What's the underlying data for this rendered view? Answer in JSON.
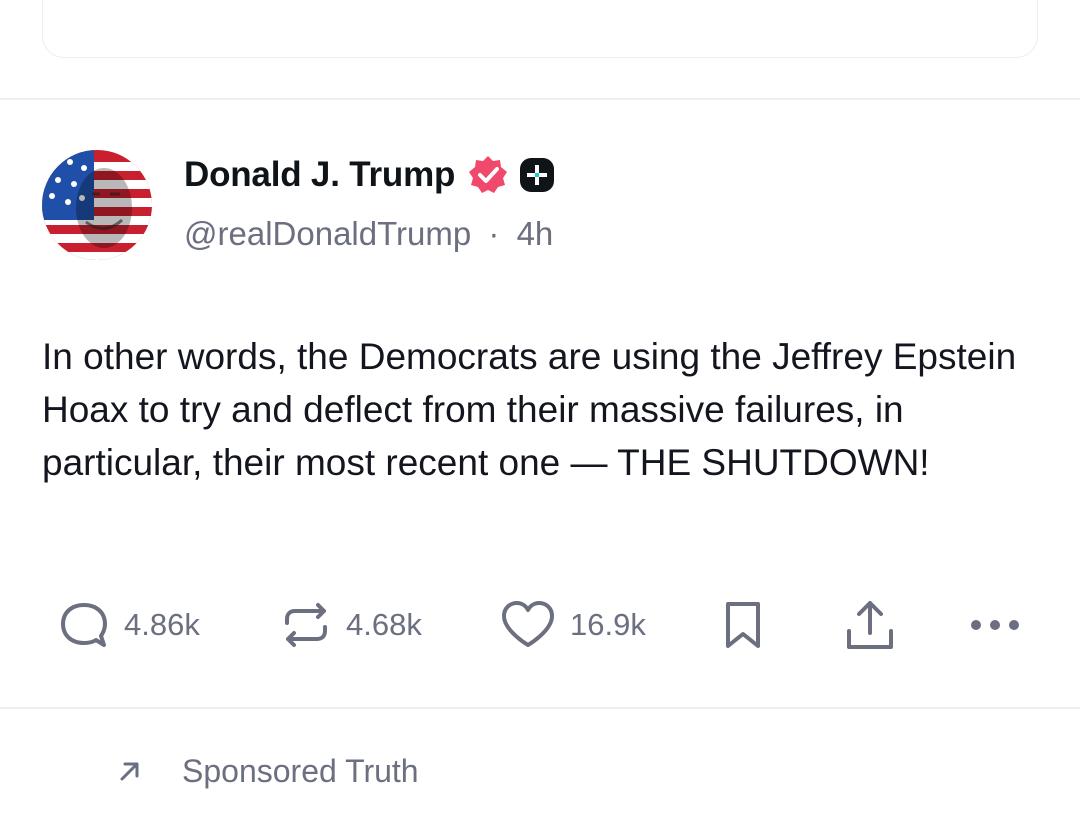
{
  "post": {
    "author_name": "Donald J. Trump",
    "handle": "@realDonaldTrump",
    "separator": "·",
    "time": "4h",
    "text": "In other words, the Democrats are using the Jeffrey Epstein Hoax to try and deflect from their massive failures, in particular, their most recent one — THE SHUTDOWN!",
    "avatar_icon": "flag-portrait-avatar",
    "badges": [
      "verified-badge-icon",
      "plus-badge-icon"
    ],
    "actions": {
      "reply_count": "4.86k",
      "retruth_count": "4.68k",
      "like_count": "16.9k"
    }
  },
  "sponsored": {
    "label": "Sponsored Truth",
    "icon": "arrow-up-right-icon"
  },
  "colors": {
    "text_primary": "#0f1419",
    "text_secondary": "#6b6f80",
    "verified_badge": "#f0496b",
    "divider": "#eceef2"
  }
}
